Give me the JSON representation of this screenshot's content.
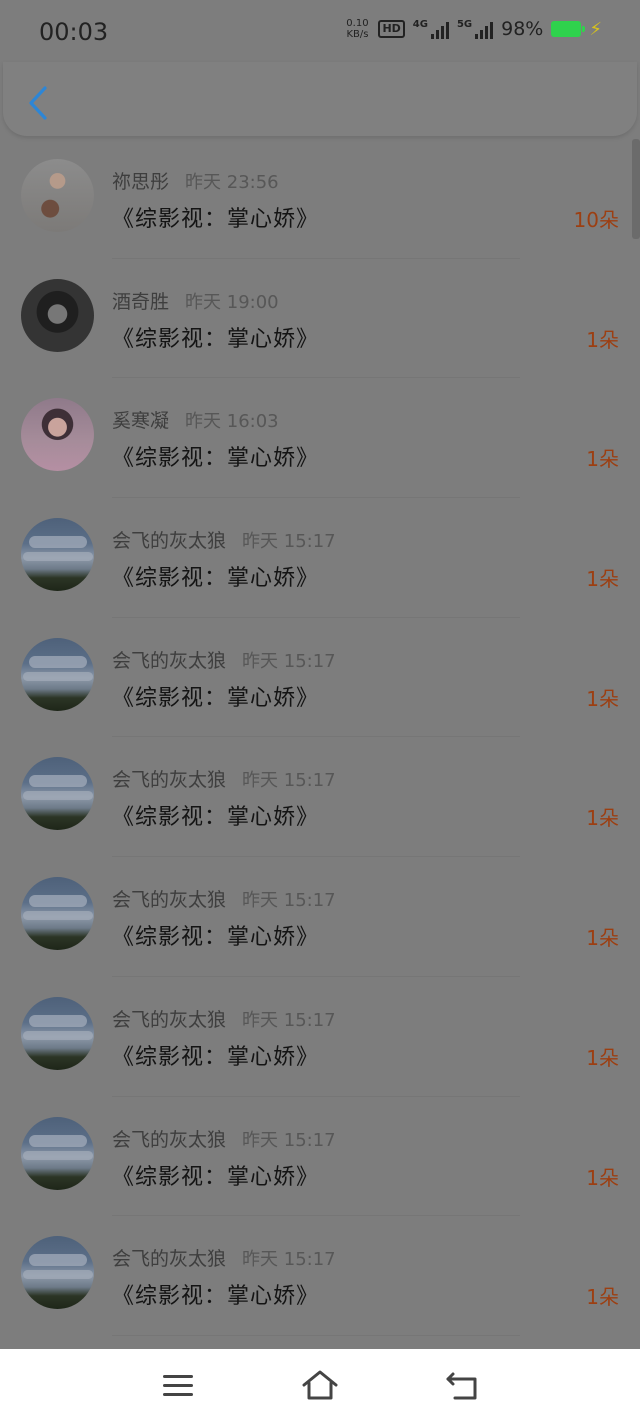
{
  "status_bar": {
    "time": "00:03",
    "net_speed_value": "0.10",
    "net_speed_unit": "KB/s",
    "hd_label": "HD",
    "sim1_label": "4G",
    "sim2_label": "5G",
    "battery_pct": "98%",
    "battery_color": "#2fd24d"
  },
  "nav": {
    "back_icon": "chevron-left-icon",
    "back_color": "#2d86d6"
  },
  "items": [
    {
      "name": "祢思彤",
      "time": "昨天 23:56",
      "book": "《综影视：掌心娇》",
      "count": "10朵",
      "avatar": "person-photo"
    },
    {
      "name": "酒奇胜",
      "time": "昨天 19:00",
      "book": "《综影视：掌心娇》",
      "count": "1朵",
      "avatar": "dark-photo"
    },
    {
      "name": "奚寒凝",
      "time": "昨天 16:03",
      "book": "《综影视：掌心娇》",
      "count": "1朵",
      "avatar": "anime-girl"
    },
    {
      "name": "会飞的灰太狼",
      "time": "昨天 15:17",
      "book": "《综影视：掌心娇》",
      "count": "1朵",
      "avatar": "sky-landscape"
    },
    {
      "name": "会飞的灰太狼",
      "time": "昨天 15:17",
      "book": "《综影视：掌心娇》",
      "count": "1朵",
      "avatar": "sky-landscape"
    },
    {
      "name": "会飞的灰太狼",
      "time": "昨天 15:17",
      "book": "《综影视：掌心娇》",
      "count": "1朵",
      "avatar": "sky-landscape"
    },
    {
      "name": "会飞的灰太狼",
      "time": "昨天 15:17",
      "book": "《综影视：掌心娇》",
      "count": "1朵",
      "avatar": "sky-landscape"
    },
    {
      "name": "会飞的灰太狼",
      "time": "昨天 15:17",
      "book": "《综影视：掌心娇》",
      "count": "1朵",
      "avatar": "sky-landscape"
    },
    {
      "name": "会飞的灰太狼",
      "time": "昨天 15:17",
      "book": "《综影视：掌心娇》",
      "count": "1朵",
      "avatar": "sky-landscape"
    },
    {
      "name": "会飞的灰太狼",
      "time": "昨天 15:17",
      "book": "《综影视：掌心娇》",
      "count": "1朵",
      "avatar": "sky-landscape"
    }
  ],
  "system_nav": {
    "menu_icon": "menu-icon",
    "home_icon": "home-icon",
    "back_icon": "back-icon"
  }
}
